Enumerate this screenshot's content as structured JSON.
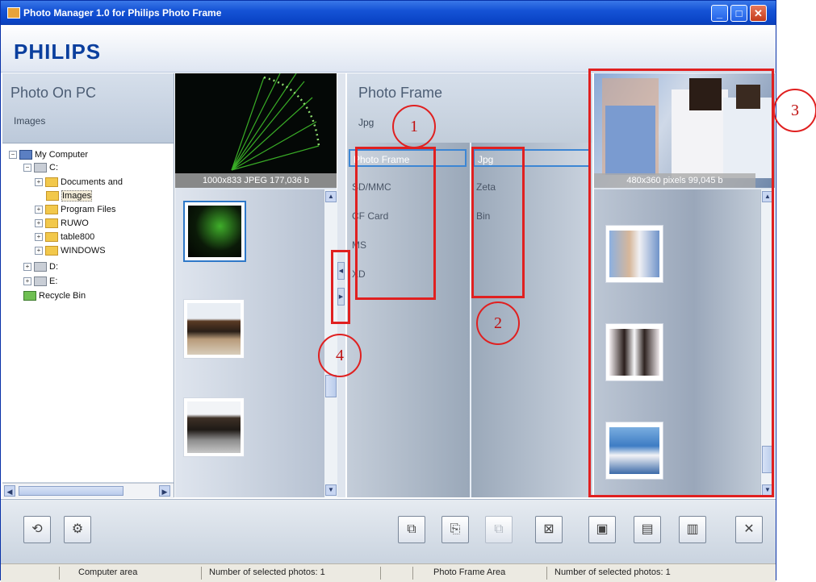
{
  "window": {
    "title": "Photo Manager 1.0 for Philips Photo Frame",
    "minimize_glyph": "_",
    "maximize_glyph": "□",
    "close_glyph": "✕"
  },
  "brand": "PHILIPS",
  "pc_panel": {
    "title": "Photo On PC",
    "current_folder": "Images",
    "tree": [
      {
        "label": "My Computer",
        "toggle": "−",
        "icon": "computer-icon"
      },
      {
        "label": "C:",
        "toggle": "−",
        "icon": "drive-icon"
      },
      {
        "label": "Documents and",
        "toggle": "+",
        "icon": "folder-icon"
      },
      {
        "label": "Images",
        "toggle": "",
        "icon": "folder-icon"
      },
      {
        "label": "Program Files",
        "toggle": "+",
        "icon": "folder-icon"
      },
      {
        "label": "RUWO",
        "toggle": "+",
        "icon": "folder-icon"
      },
      {
        "label": "table800",
        "toggle": "+",
        "icon": "folder-icon"
      },
      {
        "label": "WINDOWS",
        "toggle": "+",
        "icon": "folder-icon"
      },
      {
        "label": "D:",
        "toggle": "+",
        "icon": "drive-icon"
      },
      {
        "label": "E:",
        "toggle": "+",
        "icon": "drive-icon"
      },
      {
        "label": "Recycle Bin",
        "toggle": "",
        "icon": "recycle-bin-icon"
      }
    ],
    "preview_caption": "1000x833 JPEG 177,036 b",
    "scroll_up": "▲",
    "scroll_down": "▼",
    "scroll_left": "◀",
    "scroll_right": "▶"
  },
  "splitter": {
    "left_arrow": "◀",
    "right_arrow": "▶"
  },
  "frame_panel": {
    "title": "Photo Frame",
    "current_folder": "Jpg",
    "sources": [
      "Photo Frame",
      "SD/MMC",
      "CF Card",
      "MS",
      "XD"
    ],
    "folders": [
      "Jpg",
      "Zeta",
      "Bin"
    ],
    "preview_caption": "480x360 pixels 99,045 b"
  },
  "toolbar": {
    "left_buttons": [
      {
        "name": "rotate-button",
        "glyph": "⟲"
      },
      {
        "name": "settings-button",
        "glyph": "⚙"
      }
    ],
    "right_buttons": [
      {
        "name": "copy-button",
        "glyph": "⧉",
        "disabled": false
      },
      {
        "name": "copy-to-frame-button",
        "glyph": "⎘",
        "disabled": false
      },
      {
        "name": "paste-button",
        "glyph": "⧉",
        "disabled": true
      },
      {
        "name": "delete-photo-button",
        "glyph": "⊠",
        "disabled": false
      },
      {
        "name": "crop-photo-button",
        "glyph": "▣",
        "disabled": false
      },
      {
        "name": "edit-photo-button",
        "glyph": "▤",
        "disabled": false
      },
      {
        "name": "slideshow-button",
        "glyph": "▥",
        "disabled": false
      },
      {
        "name": "close-app-button",
        "glyph": "✕",
        "disabled": false
      }
    ]
  },
  "status": {
    "left_area": "Computer area",
    "left_count": "Number of selected photos: 1",
    "right_area": "Photo Frame Area",
    "right_count": "Number of selected photos: 1"
  },
  "callouts": [
    "1",
    "2",
    "3",
    "4"
  ],
  "colors": {
    "callout": "#e02020",
    "brand": "#0b3f9e",
    "selection": "#3c86d4"
  }
}
